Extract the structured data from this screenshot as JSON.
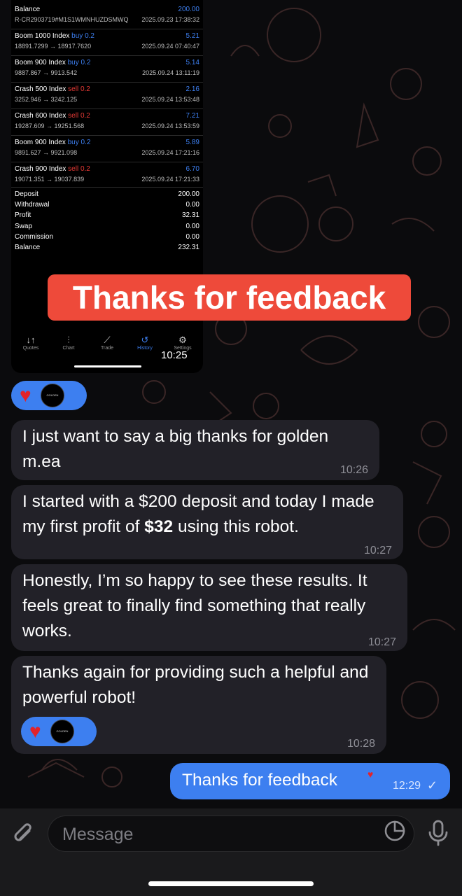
{
  "screenshot": {
    "account": {
      "title": "Balance",
      "id": "R-CR2903719#M1S1WMNHUZDSMWQ",
      "value": "200.00",
      "datetime": "2025.09.23 17:38:32"
    },
    "trades": [
      {
        "symbol": "Boom 1000 Index",
        "side": "buy 0.2",
        "dir": "buy",
        "prices": "18891.7299 → 18917.7620",
        "profit": "5.21",
        "datetime": "2025.09.24 07:40:47"
      },
      {
        "symbol": "Boom 900 Index",
        "side": "buy 0.2",
        "dir": "buy",
        "prices": "9887.867 → 9913.542",
        "profit": "5.14",
        "datetime": "2025.09.24 13:11:19"
      },
      {
        "symbol": "Crash 500 Index",
        "side": "sell 0.2",
        "dir": "sell",
        "prices": "3252.946 → 3242.125",
        "profit": "2.16",
        "datetime": "2025.09.24 13:53:48"
      },
      {
        "symbol": "Crash 600 Index",
        "side": "sell 0.2",
        "dir": "sell",
        "prices": "19287.609 → 19251.568",
        "profit": "7.21",
        "datetime": "2025.09.24 13:53:59"
      },
      {
        "symbol": "Boom 900 Index",
        "side": "buy 0.2",
        "dir": "buy",
        "prices": "9891.627 → 9921.098",
        "profit": "5.89",
        "datetime": "2025.09.24 17:21:16"
      },
      {
        "symbol": "Crash 900 Index",
        "side": "sell 0.2",
        "dir": "sell",
        "prices": "19071.351 → 19037.839",
        "profit": "6.70",
        "datetime": "2025.09.24 17:21:33"
      }
    ],
    "summary": [
      {
        "label": "Deposit",
        "value": "200.00"
      },
      {
        "label": "Withdrawal",
        "value": "0.00"
      },
      {
        "label": "Profit",
        "value": "32.31"
      },
      {
        "label": "Swap",
        "value": "0.00"
      },
      {
        "label": "Commission",
        "value": "0.00"
      },
      {
        "label": "Balance",
        "value": "232.31"
      }
    ],
    "tabs": [
      {
        "label": "Quotes",
        "icon": "↓↑"
      },
      {
        "label": "Chart",
        "icon": "⫶"
      },
      {
        "label": "Trade",
        "icon": "⟋"
      },
      {
        "label": "History",
        "icon": "↺"
      },
      {
        "label": "Settings",
        "icon": "⚙"
      }
    ],
    "time": "10:25",
    "caption": "Thanks for feedback"
  },
  "messages": [
    {
      "text": "I just want to say a big thanks for golden m.ea",
      "time": "10:26"
    },
    {
      "text": "I started with a $200 deposit and today I made my first profit of ",
      "bold": "$32",
      "text_after": " using this robot.",
      "time": "10:27"
    },
    {
      "text": "Honestly, I’m so happy to see these results. It feels great to finally find something that really works.",
      "time": "10:27"
    },
    {
      "text": "Thanks again for providing such a helpful and powerful robot!",
      "time": "10:28"
    }
  ],
  "reaction": {
    "emoji": "♥",
    "avatar_text": "GOLDEN"
  },
  "outgoing": {
    "text": "Thanks for feedback",
    "time": "12:29",
    "status": "✓",
    "reaction": "♥"
  },
  "input": {
    "placeholder": "Message"
  },
  "colors": {
    "accent": "#3d7ff0",
    "caption_bg": "#ee4a3a",
    "bubble_in": "#222128",
    "sell": "#e53935"
  }
}
